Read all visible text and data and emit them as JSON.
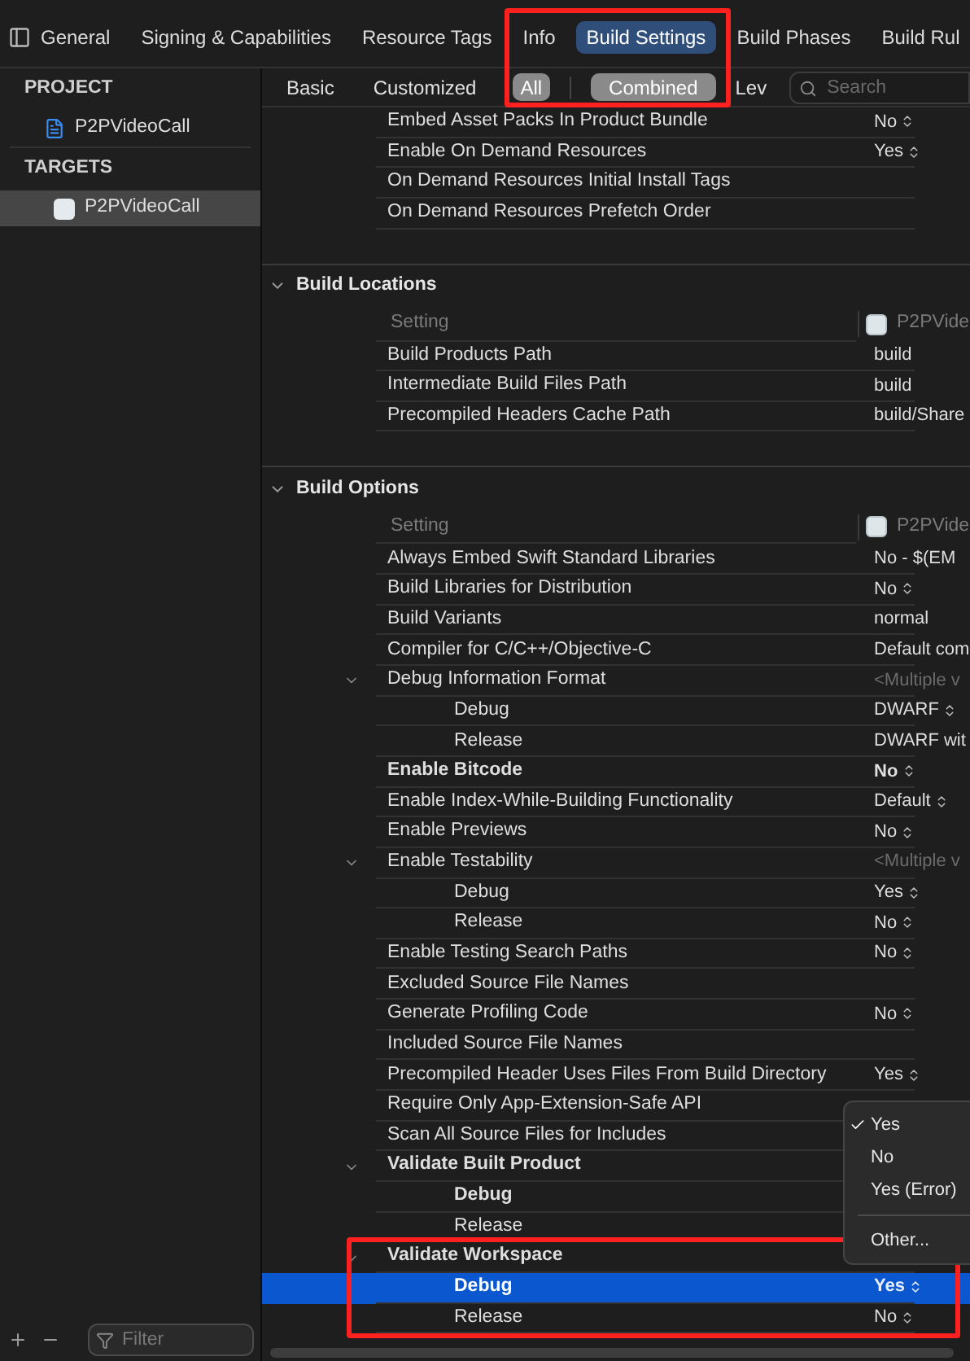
{
  "tabs": [
    {
      "label": "General",
      "selected": false
    },
    {
      "label": "Signing & Capabilities",
      "selected": false
    },
    {
      "label": "Resource Tags",
      "selected": false
    },
    {
      "label": "Info",
      "selected": false
    },
    {
      "label": "Build Settings",
      "selected": true
    },
    {
      "label": "Build Phases",
      "selected": false
    },
    {
      "label": "Build Rul",
      "selected": false
    }
  ],
  "filters": [
    {
      "label": "Basic",
      "selected": false,
      "kind": "scope"
    },
    {
      "label": "Customized",
      "selected": false,
      "kind": "scope"
    },
    {
      "label": "All",
      "selected": true,
      "kind": "scope"
    },
    {
      "label": "Combined",
      "selected": true,
      "kind": "view"
    },
    {
      "label": "Lev",
      "selected": false,
      "kind": "view"
    }
  ],
  "search": {
    "placeholder": "Search"
  },
  "sidebar": {
    "groups": [
      {
        "title": "PROJECT",
        "items": [
          {
            "label": "P2PVideoCall",
            "kind": "project",
            "selected": false
          }
        ]
      },
      {
        "title": "TARGETS",
        "items": [
          {
            "label": "P2PVideoCall",
            "kind": "target",
            "selected": true
          }
        ]
      }
    ],
    "filter": {
      "placeholder": "Filter"
    }
  },
  "sections": [
    {
      "rows": [
        {
          "name": "Embed Asset Packs In Product Bundle",
          "value": "No",
          "stepper": true,
          "bold": false,
          "selected": false
        },
        {
          "name": "Enable On Demand Resources",
          "value": "Yes",
          "stepper": true,
          "bold": false,
          "selected": false
        },
        {
          "name": "On Demand Resources Initial Install Tags",
          "bold": false,
          "selected": false
        },
        {
          "name": "On Demand Resources Prefetch Order",
          "bold": false,
          "selected": false
        }
      ]
    },
    {
      "title": "Build Locations",
      "expanded": true,
      "header": {
        "setting": "Setting",
        "target": "P2PVide"
      },
      "rows": [
        {
          "name": "Build Products Path",
          "value": "build",
          "stepper": false,
          "bold": false,
          "selected": false
        },
        {
          "name": "Intermediate Build Files Path",
          "value": "build",
          "stepper": false,
          "bold": false,
          "selected": false
        },
        {
          "name": "Precompiled Headers Cache Path",
          "value": "build/Share",
          "stepper": false,
          "bold": false,
          "selected": false
        }
      ]
    },
    {
      "title": "Build Options",
      "expanded": true,
      "header": {
        "setting": "Setting",
        "target": "P2PVide"
      },
      "rows": [
        {
          "name": "Always Embed Swift Standard Libraries",
          "value": "No  -  $(EM",
          "stepper": false,
          "bold": false,
          "selected": false
        },
        {
          "name": "Build Libraries for Distribution",
          "value": "No",
          "stepper": true,
          "bold": false,
          "selected": false
        },
        {
          "name": "Build Variants",
          "value": "normal",
          "stepper": false,
          "bold": false,
          "selected": false
        },
        {
          "name": "Compiler for C/C++/Objective-C",
          "value": "Default com",
          "stepper": false,
          "bold": false,
          "selected": false
        },
        {
          "name": "Debug Information Format",
          "value": "<Multiple v",
          "stepper": false,
          "bold": false,
          "selected": false,
          "expanded": true,
          "children": [
            {
              "name": "Debug",
              "value": "DWARF",
              "stepper": true,
              "bold": false,
              "selected": false
            },
            {
              "name": "Release",
              "value": "DWARF wit",
              "stepper": false,
              "bold": false,
              "selected": false
            }
          ]
        },
        {
          "name": "Enable Bitcode",
          "value": "No",
          "stepper": true,
          "bold": true,
          "selected": false
        },
        {
          "name": "Enable Index-While-Building Functionality",
          "value": "Default",
          "stepper": true,
          "bold": false,
          "selected": false
        },
        {
          "name": "Enable Previews",
          "value": "No",
          "stepper": true,
          "bold": false,
          "selected": false
        },
        {
          "name": "Enable Testability",
          "value": "<Multiple v",
          "stepper": false,
          "bold": false,
          "selected": false,
          "expanded": true,
          "children": [
            {
              "name": "Debug",
              "value": "Yes",
              "stepper": true,
              "bold": false,
              "selected": false
            },
            {
              "name": "Release",
              "value": "No",
              "stepper": true,
              "bold": false,
              "selected": false
            }
          ]
        },
        {
          "name": "Enable Testing Search Paths",
          "value": "No",
          "stepper": true,
          "bold": false,
          "selected": false
        },
        {
          "name": "Excluded Source File Names",
          "bold": false,
          "selected": false
        },
        {
          "name": "Generate Profiling Code",
          "value": "No",
          "stepper": true,
          "bold": false,
          "selected": false
        },
        {
          "name": "Included Source File Names",
          "bold": false,
          "selected": false
        },
        {
          "name": "Precompiled Header Uses Files From Build Directory",
          "value": "Yes",
          "stepper": true,
          "bold": false,
          "selected": false
        },
        {
          "name": "Require Only App-Extension-Safe API",
          "bold": false,
          "selected": false
        },
        {
          "name": "Scan All Source Files for Includes",
          "bold": false,
          "selected": false
        },
        {
          "name": "Validate Built Product",
          "bold": true,
          "selected": false,
          "expanded": true,
          "children": [
            {
              "name": "Debug",
              "bold": true,
              "selected": false
            },
            {
              "name": "Release",
              "bold": false,
              "selected": false
            }
          ]
        },
        {
          "name": "Validate Workspace",
          "bold": true,
          "selected": false,
          "expanded": true,
          "children": [
            {
              "name": "Debug",
              "value": "Yes",
              "stepper": true,
              "bold": true,
              "selected": true
            },
            {
              "name": "Release",
              "value": "No",
              "stepper": true,
              "bold": false,
              "selected": false
            }
          ]
        }
      ]
    }
  ],
  "menu": {
    "items": [
      {
        "kind": "option",
        "label": "Yes",
        "checked": true
      },
      {
        "kind": "option",
        "label": "No",
        "checked": false
      },
      {
        "kind": "option",
        "label": "Yes (Error)",
        "checked": false
      },
      {
        "kind": "separator"
      },
      {
        "kind": "option",
        "label": "Other...",
        "checked": false
      }
    ]
  }
}
